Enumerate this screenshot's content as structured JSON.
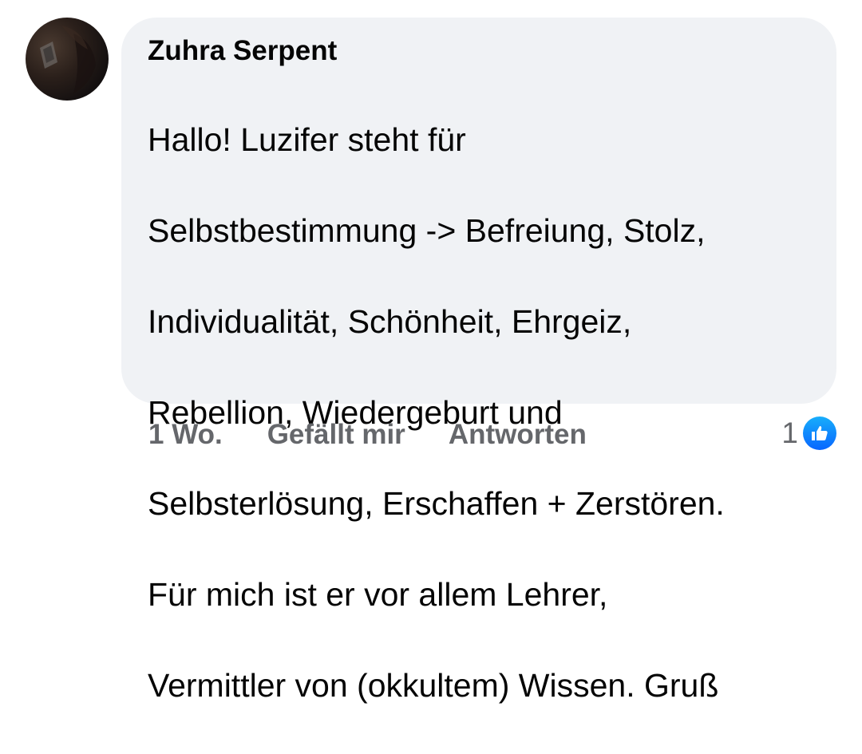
{
  "comment": {
    "author": "Zuhra Serpent",
    "text_lines": [
      "Hallo! Luzifer steht für",
      "Selbstbestimmung -> Befreiung, Stolz,",
      "Individualität, Schönheit, Ehrgeiz,",
      "Rebellion, Wiedergeburt und",
      "Selbsterlösung, Erschaffen + Zerstören.",
      "Für mich ist er vor allem Lehrer,",
      "Vermittler von (okkultem) Wissen. Gruß"
    ],
    "avatar_icon": "user-avatar"
  },
  "actions": {
    "timestamp": "1 Wo.",
    "like_label": "Gefällt mir",
    "reply_label": "Antworten"
  },
  "reactions": {
    "count": "1",
    "icon": "thumbs-up-icon",
    "badge_color": "#1877f2"
  }
}
